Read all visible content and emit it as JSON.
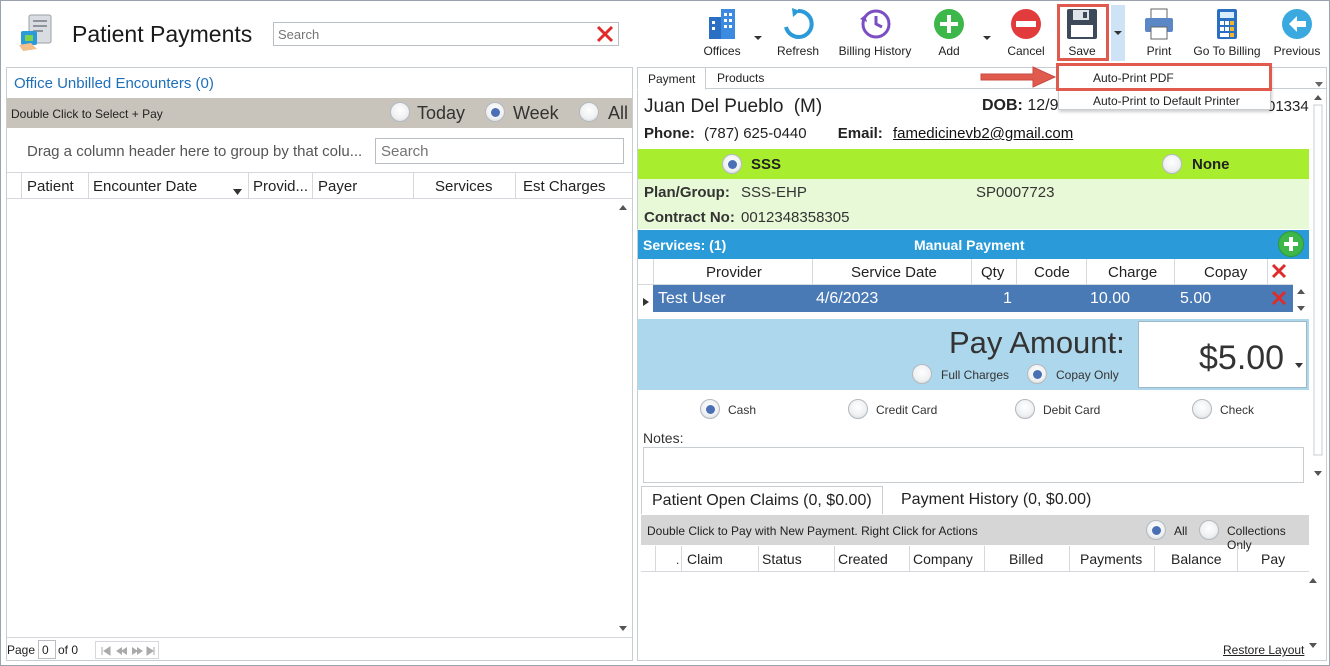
{
  "app": {
    "title": "Patient Payments",
    "search_placeholder": "Search"
  },
  "toolbar": {
    "offices": "Offices",
    "refresh": "Refresh",
    "billing_history": "Billing History",
    "add": "Add",
    "cancel": "Cancel",
    "save": "Save",
    "print": "Print",
    "go_to_billing": "Go To Billing",
    "previous": "Previous"
  },
  "save_menu": {
    "items": [
      "Auto-Print PDF",
      "Auto-Print to Default Printer"
    ],
    "highlighted": "Auto-Print PDF"
  },
  "left": {
    "title": "Office Unbilled Encounters (0)",
    "instruction": "Double Click to Select + Pay",
    "filters": [
      "Today",
      "Week",
      "All"
    ],
    "selected_filter": "Week",
    "group_hint": "Drag a column header here to group by that colu...",
    "search_placeholder": "Search",
    "columns": [
      "Patient",
      "Encounter Date",
      "Provid...",
      "Payer",
      "Services",
      "Est Charges"
    ],
    "pager": {
      "page_label": "Page",
      "page": "0",
      "of": "of 0"
    }
  },
  "right": {
    "tabs": [
      "Payment",
      "Products"
    ],
    "active_tab": "Payment",
    "patient": {
      "name": "Juan Del Pueblo",
      "sex": "(M)",
      "dob_label": "DOB:",
      "dob_value": "12/9",
      "id_fragment": "01334",
      "phone_label": "Phone:",
      "phone": "(787) 625-0440",
      "email_label": "Email:",
      "email": "famedicinevb2@gmail.com"
    },
    "insurance": {
      "options": [
        "SSS",
        "None"
      ],
      "selected": "SSS",
      "plan_label": "Plan/Group:",
      "plan": "SSS-EHP",
      "group": "SP0007723",
      "contract_label": "Contract No:",
      "contract": "0012348358305"
    },
    "services": {
      "title": "Services: (1)",
      "mode": "Manual Payment",
      "columns": [
        "Provider",
        "Service Date",
        "Qty",
        "Code",
        "Charge",
        "Copay"
      ],
      "rows": [
        {
          "provider": "Test User",
          "date": "4/6/2023",
          "qty": "1",
          "code": "",
          "charge": "10.00",
          "copay": "5.00"
        }
      ]
    },
    "payment": {
      "label": "Pay Amount:",
      "amount": "$5.00",
      "charge_options": [
        "Full Charges",
        "Copay Only"
      ],
      "selected_charge": "Copay Only",
      "methods": [
        "Cash",
        "Credit Card",
        "Debit Card",
        "Check"
      ],
      "selected_method": "Cash",
      "notes_label": "Notes:"
    },
    "claims": {
      "tabs": [
        "Patient Open Claims (0, $0.00)",
        "Payment History (0, $0.00)"
      ],
      "active_tab": "Patient Open Claims (0, $0.00)",
      "instruction": "Double Click to Pay with New Payment. Right Click for Actions",
      "filters": [
        "All",
        "Collections Only"
      ],
      "selected_filter": "All",
      "columns": [
        "Claim",
        "Status",
        "Created",
        "Company",
        "Billed",
        "Payments",
        "Balance",
        "Pay"
      ],
      "restore_layout": "Restore Layout"
    }
  },
  "colors": {
    "accent_blue": "#2a9ad8",
    "insurance_green": "#a8ee2f",
    "row_selected": "#4a7ab5",
    "pay_band": "#add7ec",
    "highlight_red": "#e05a4e"
  }
}
